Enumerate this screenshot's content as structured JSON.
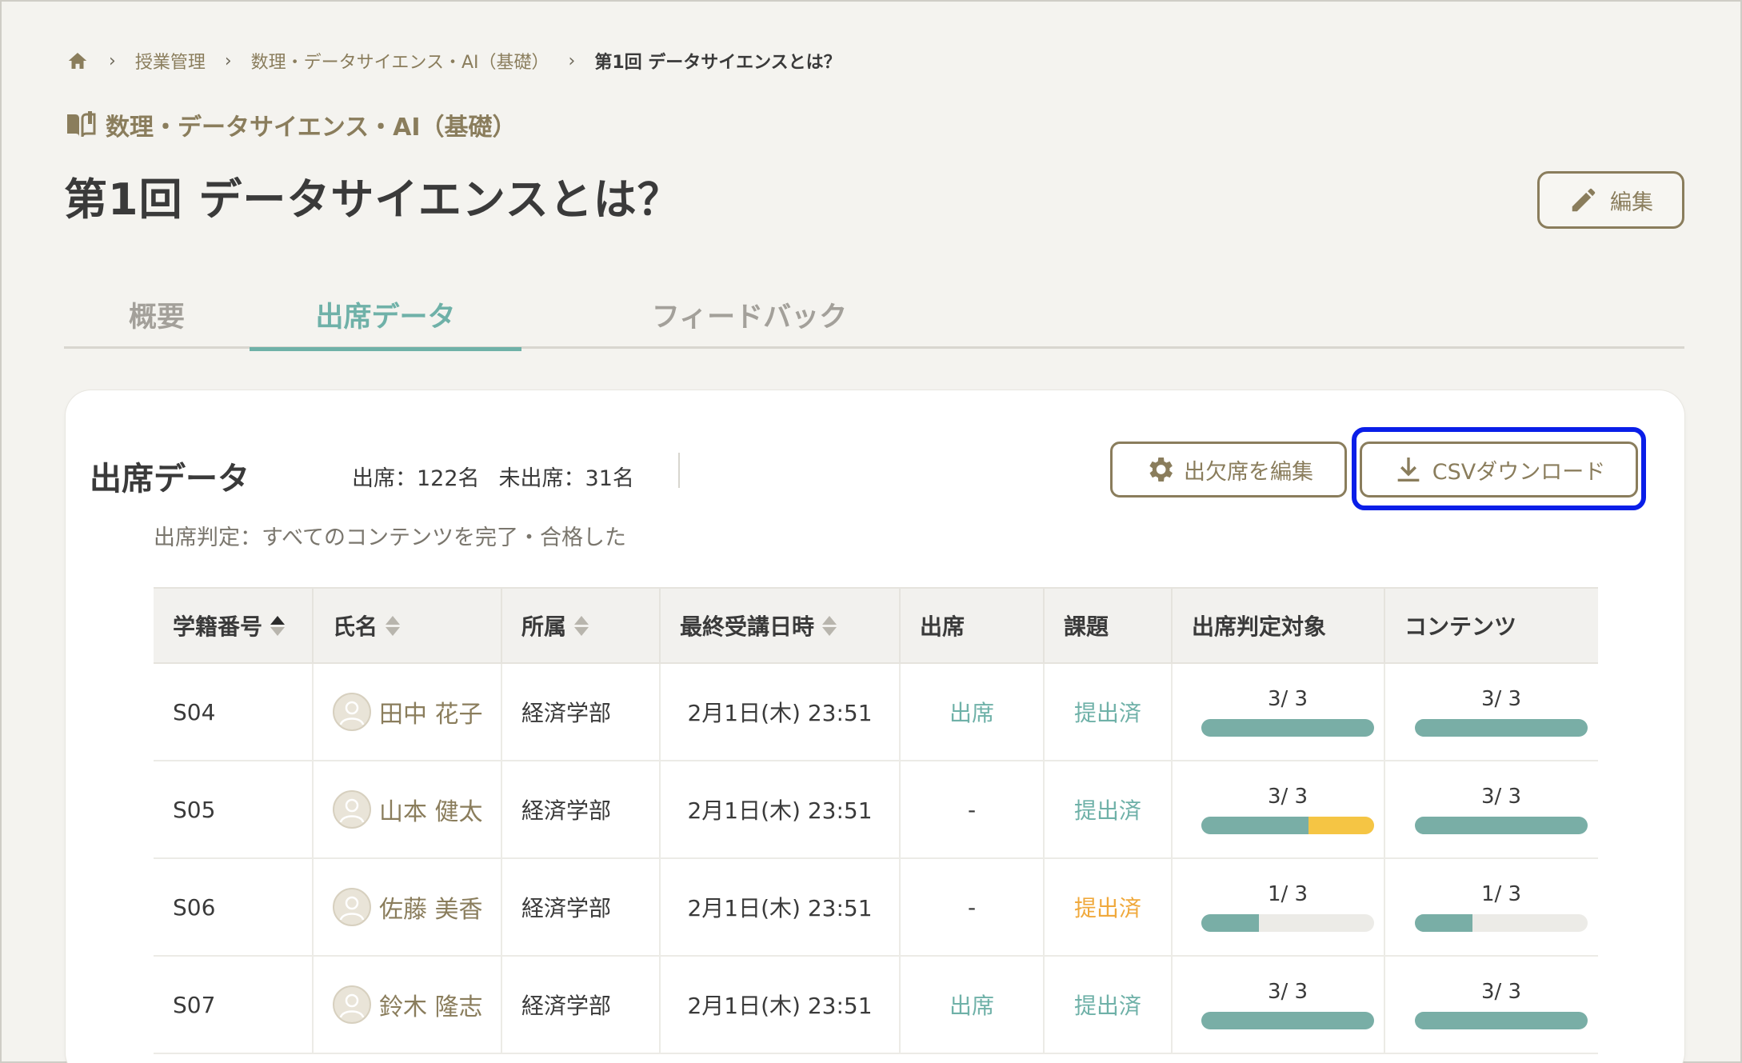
{
  "breadcrumb": {
    "items": [
      "授業管理",
      "数理・データサイエンス・AI（基礎）"
    ],
    "current": "第1回 データサイエンスとは？"
  },
  "course_label": "数理・データサイエンス・AI（基礎）",
  "page_title": "第1回 データサイエンスとは？",
  "edit_label": "編集",
  "tabs": [
    {
      "label": "概要"
    },
    {
      "label": "出席データ"
    },
    {
      "label": "フィードバック"
    }
  ],
  "section": {
    "title": "出席データ",
    "attended": "出席：122名",
    "absent": "未出席：31名",
    "criteria": "出席判定：すべてのコンテンツを完了・合格した",
    "edit_attendance_label": "出欠席を編集",
    "csv_label": "CSVダウンロード"
  },
  "table": {
    "headers": [
      "学籍番号",
      "氏名",
      "所属",
      "最終受講日時",
      "出席",
      "課題",
      "出席判定対象",
      "コンテンツ"
    ],
    "rows": [
      {
        "id": "S04",
        "name": "田中 花子",
        "dept": "経済学部",
        "last": "2月1日(木) 23:51",
        "attend": "出席",
        "task": "提出済",
        "target": "3/ 3",
        "target_fill": 1.0,
        "target_yellow": 0,
        "content": "3/ 3",
        "content_fill": 1.0
      },
      {
        "id": "S05",
        "name": "山本 健太",
        "dept": "経済学部",
        "last": "2月1日(木) 23:51",
        "attend": "-",
        "task": "提出済",
        "target": "3/ 3",
        "target_fill": 0.62,
        "target_yellow": 0.38,
        "content": "3/ 3",
        "content_fill": 1.0
      },
      {
        "id": "S06",
        "name": "佐藤 美香",
        "dept": "経済学部",
        "last": "2月1日(木) 23:51",
        "attend": "-",
        "task": "提出済",
        "target": "1/ 3",
        "target_fill": 0.333,
        "target_yellow": 0,
        "content": "1/ 3",
        "content_fill": 0.333
      },
      {
        "id": "S07",
        "name": "鈴木 隆志",
        "dept": "経済学部",
        "last": "2月1日(木) 23:51",
        "attend": "出席",
        "task": "提出済",
        "target": "3/ 3",
        "target_fill": 1.0,
        "target_yellow": 0,
        "content": "3/ 3",
        "content_fill": 1.0
      }
    ]
  },
  "colors": {
    "accent_teal": "#6fb1a8",
    "brand_olive": "#8a7d5c",
    "warning_orange": "#f0a93c",
    "bar_yellow": "#f5c544",
    "highlight_blue": "#0a1ee8"
  }
}
